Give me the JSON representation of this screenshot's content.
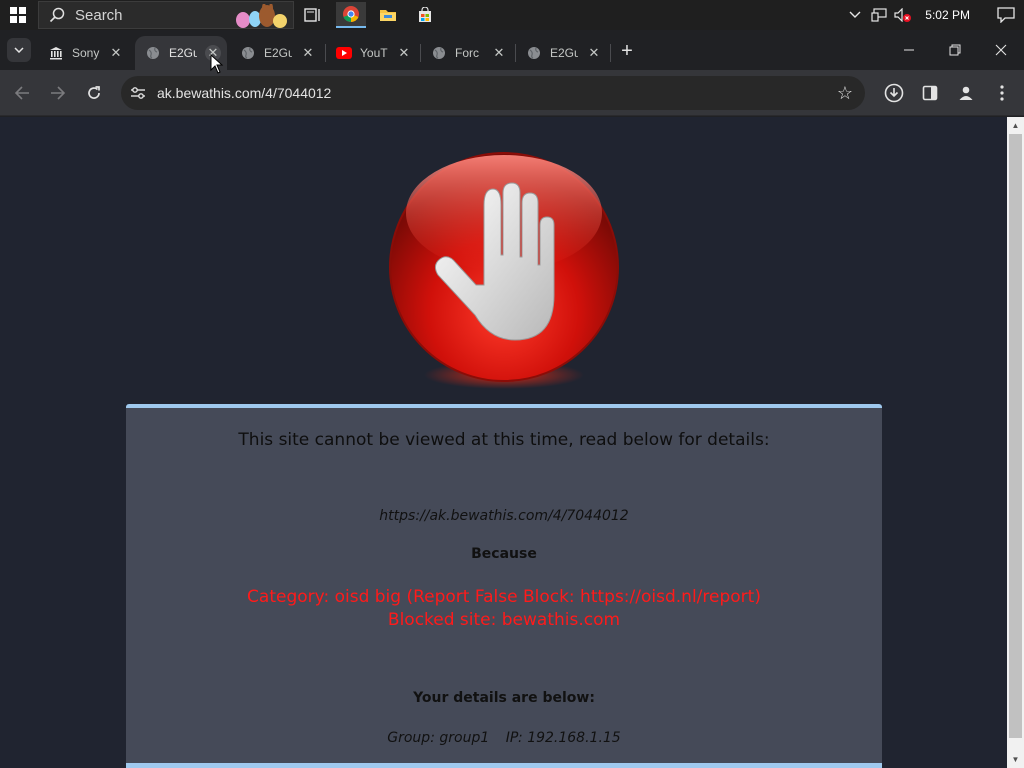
{
  "taskbar": {
    "search_placeholder": "Search",
    "clock": "5:02 PM",
    "apps": [
      "task-view-icon",
      "chrome-icon",
      "file-explorer-icon",
      "store-icon"
    ]
  },
  "tabs": [
    {
      "title": "Sony",
      "favicon": "museum-icon",
      "active": false
    },
    {
      "title": "E2Gu",
      "favicon": "globe-icon",
      "active": true
    },
    {
      "title": "E2Gu",
      "favicon": "globe-icon",
      "active": false
    },
    {
      "title": "YouT",
      "favicon": "youtube-icon",
      "active": false
    },
    {
      "title": "Forc",
      "favicon": "globe-icon",
      "active": false
    },
    {
      "title": "E2Gu",
      "favicon": "globe-icon",
      "active": false
    }
  ],
  "toolbar": {
    "url": "ak.bewathis.com/4/7044012"
  },
  "block": {
    "title": "This site cannot be viewed at this time, read below for details:",
    "blocked_url": "https://ak.bewathis.com/4/7044012",
    "because": "Because",
    "category": "Category: oisd big (Report False Block: https://oisd.nl/report)",
    "blocked_site": "Blocked site: bewathis.com",
    "details_heading": "Your details are below:",
    "group": "Group: group1",
    "ip": "IP: 192.168.1.15"
  },
  "colors": {
    "panel_bg": "#454a58",
    "panel_accent": "#9fc9ee",
    "page_bg": "#202430",
    "alert_red": "#ff1a1a"
  }
}
